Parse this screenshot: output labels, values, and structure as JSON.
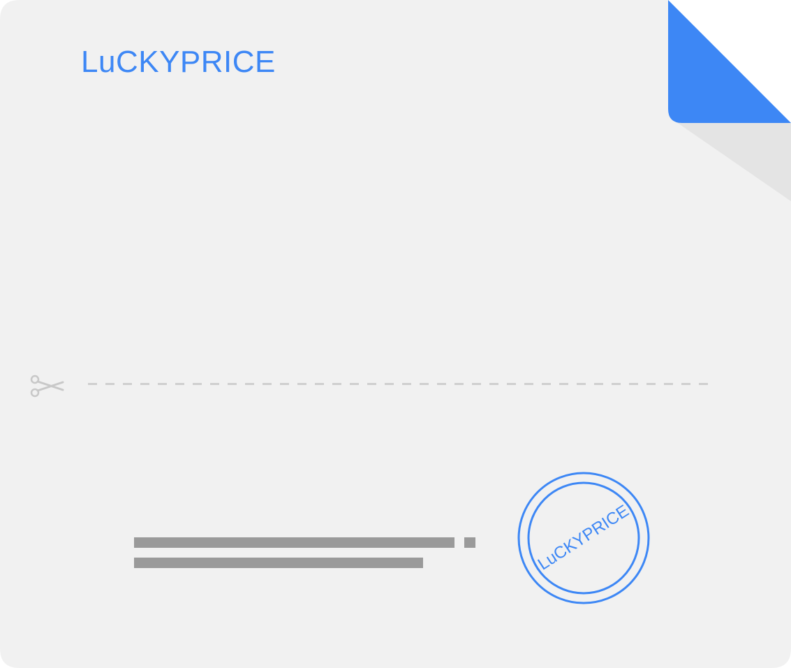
{
  "brand": {
    "title": "LuCKYPRICE"
  },
  "stamp": {
    "text": "LuCKYPRICE"
  },
  "icons": {
    "cut": "scissors-icon"
  },
  "colors": {
    "accent": "#3d87f5",
    "card_background": "#f1f1f1",
    "fold_shadow": "#e4e4e4",
    "placeholder_lines": "#9a9a9a",
    "cut_line": "#cfcfcf"
  }
}
